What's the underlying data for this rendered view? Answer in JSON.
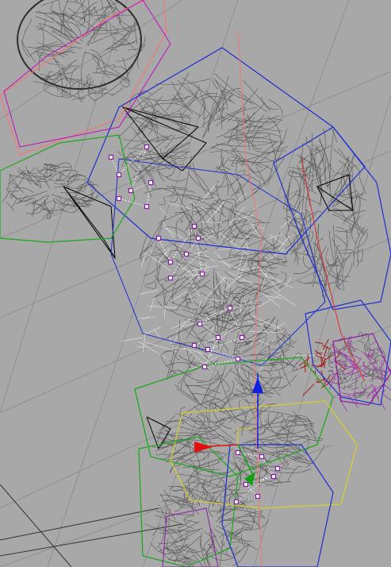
{
  "viewport": {
    "view": "perspective",
    "shading": "wireframe",
    "background_color": "#a8a8a8",
    "grid_color": "#8f8f8f",
    "mesh_color": "#4a4a4a",
    "highlight_color": "#ffffff"
  },
  "bones": {
    "colors": {
      "blue": "#1f2fd0",
      "green": "#1aa81a",
      "yellow": "#d8d028",
      "purple": "#8a1aa8",
      "red": "#e03030",
      "magenta": "#c010c0",
      "pink": "#f07878",
      "dark_red": "#a01010"
    }
  },
  "gizmo": {
    "type": "move-transform-gizmo",
    "axes": [
      {
        "axis": "x",
        "color": "#e01010"
      },
      {
        "axis": "y",
        "color": "#10a010"
      },
      {
        "axis": "z",
        "color": "#1020e0"
      }
    ]
  },
  "selection_color": "#a040a8"
}
